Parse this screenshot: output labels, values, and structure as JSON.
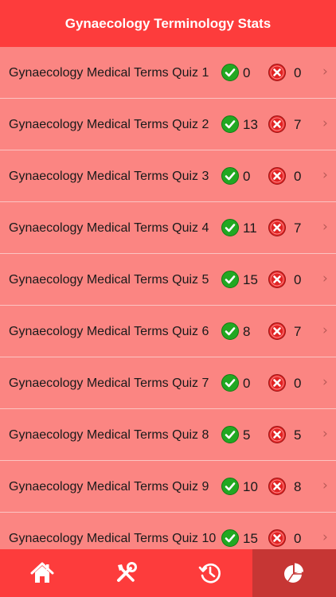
{
  "header": {
    "title": "Gynaecology Terminology Stats"
  },
  "quizzes": [
    {
      "label": "Gynaecology Medical Terms Quiz 1",
      "correct": "0",
      "wrong": "0"
    },
    {
      "label": "Gynaecology Medical Terms Quiz 2",
      "correct": "13",
      "wrong": "7"
    },
    {
      "label": "Gynaecology Medical Terms Quiz 3",
      "correct": "0",
      "wrong": "0"
    },
    {
      "label": "Gynaecology Medical Terms Quiz 4",
      "correct": "11",
      "wrong": "7"
    },
    {
      "label": "Gynaecology Medical Terms Quiz 5",
      "correct": "15",
      "wrong": "0"
    },
    {
      "label": "Gynaecology Medical Terms Quiz 6",
      "correct": "8",
      "wrong": "7"
    },
    {
      "label": "Gynaecology Medical Terms Quiz 7",
      "correct": "0",
      "wrong": "0"
    },
    {
      "label": "Gynaecology Medical Terms Quiz 8",
      "correct": "5",
      "wrong": "5"
    },
    {
      "label": "Gynaecology Medical Terms Quiz 9",
      "correct": "10",
      "wrong": "8"
    },
    {
      "label": "Gynaecology Medical Terms Quiz 10",
      "correct": "15",
      "wrong": "0"
    }
  ],
  "tabs": [
    {
      "icon": "home-icon"
    },
    {
      "icon": "tools-icon"
    },
    {
      "icon": "history-icon"
    },
    {
      "icon": "pie-chart-icon",
      "active": true
    }
  ],
  "colors": {
    "header": "#fd3c3c",
    "row_bg": "#fb8582",
    "tab_active": "#c63634",
    "correct": "#22a822",
    "wrong": "#e22424"
  }
}
